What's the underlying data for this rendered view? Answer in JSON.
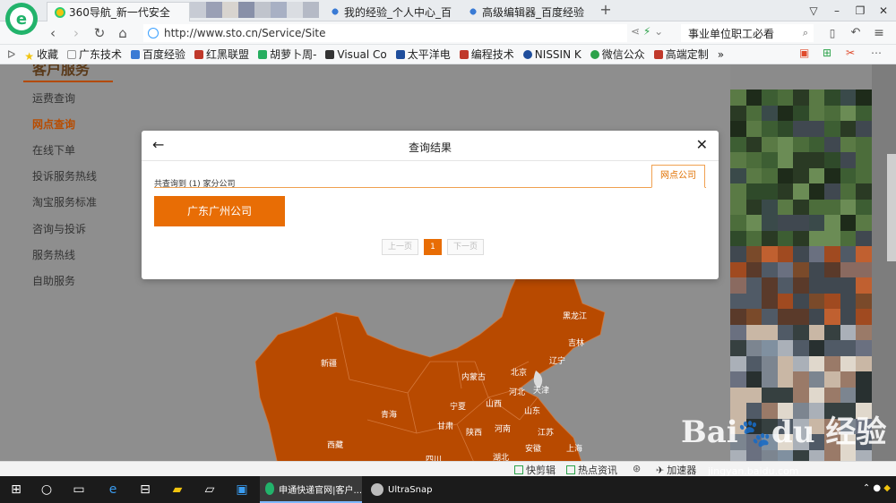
{
  "browser": {
    "tabs": [
      {
        "label": "360导航_新一代安全"
      },
      {
        "label": "我的经验_个人中心_百"
      },
      {
        "label": "高级编辑器_百度经验"
      }
    ],
    "new_tab": "+",
    "url": "http://www.sto.cn/Service/Site",
    "search_text": "事业单位职工必看",
    "bookmarks": [
      "收藏",
      "广东技术",
      "百度经验",
      "红黑联盟",
      "胡萝卜周-",
      "Visual Co",
      "太平洋电",
      "编程技术",
      "NISSIN K",
      "微信公众",
      "高端定制",
      "»"
    ],
    "accent_color": "#22b36b"
  },
  "sidebar": {
    "title": "客户服务",
    "items": [
      {
        "label": "运费查询"
      },
      {
        "label": "网点查询"
      },
      {
        "label": "在线下单"
      },
      {
        "label": "投诉服务热线"
      },
      {
        "label": "淘宝服务标准"
      },
      {
        "label": "咨询与投诉"
      },
      {
        "label": "服务热线"
      },
      {
        "label": "自助服务"
      }
    ],
    "active_item": "网点查询"
  },
  "map": {
    "color": "#b84a00",
    "labels": [
      "黑龙江",
      "吉林",
      "辽宁",
      "北京",
      "天津",
      "河北",
      "内蒙古",
      "新疆",
      "青海",
      "甘肃",
      "宁夏",
      "山西",
      "山东",
      "陕西",
      "河南",
      "西藏",
      "四川",
      "湖北",
      "安徽",
      "江苏",
      "上海"
    ]
  },
  "modal": {
    "title": "查询结果",
    "back_icon": "arrow-left-icon",
    "close": "✕",
    "result_count": "共查询到 (1) 家分公司",
    "tab_label": "网点公司",
    "company": "广东广州公司",
    "pager": {
      "prev": "上一页",
      "current": "1",
      "next": "下一页"
    },
    "accent_color": "#e86d05"
  },
  "statusbar": {
    "items": [
      "快剪辑",
      "热点资讯",
      "加速器"
    ]
  },
  "watermark": {
    "brand": "Bai",
    "brand_end": "du 经验",
    "sub": "jingyan.baidu.com"
  },
  "taskbar": {
    "apps": [
      {
        "label": "申通快递官网|客户..."
      },
      {
        "label": "UltraSnap"
      }
    ]
  }
}
